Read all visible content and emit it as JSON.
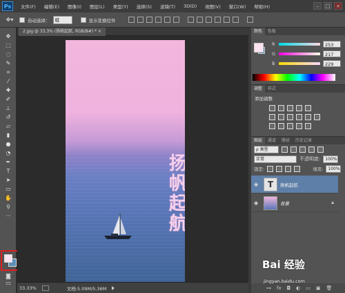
{
  "menubar": {
    "logo": "Ps",
    "items": [
      "文件(F)",
      "编辑(E)",
      "图像(I)",
      "图层(L)",
      "类型(Y)",
      "选择(S)",
      "滤镜(T)",
      "3D(D)",
      "视图(V)",
      "窗口(W)",
      "帮助(H)"
    ],
    "window_controls": [
      "–",
      "□",
      "×"
    ]
  },
  "options": {
    "auto_select_label": "自动选择：",
    "auto_select_value": "组",
    "show_transform_label": "显示变换控件"
  },
  "document": {
    "tab_title": "2.jpg @ 33.3% (扬帆起航, RGB/8#) * ×",
    "vertical_text": "扬帆起航"
  },
  "status": {
    "zoom": "33.33%",
    "doc_size": "文档:5.09M/5.36M"
  },
  "color_panel": {
    "tabs": [
      "颜色",
      "色板"
    ],
    "channels": [
      {
        "label": "R",
        "value": "253"
      },
      {
        "label": "G",
        "value": "217"
      },
      {
        "label": "B",
        "value": "229"
      }
    ]
  },
  "adjustments_panel": {
    "tabs": [
      "调整",
      "样式"
    ],
    "heading": "添加调整"
  },
  "layers_panel": {
    "tabs": [
      "图层",
      "通道",
      "路径",
      "历史记录"
    ],
    "filter": "ρ 类型",
    "blend_mode": "正常",
    "opacity_label": "不透明度:",
    "opacity_value": "100%",
    "lock_label": "锁定:",
    "fill_label": "填充:",
    "fill_value": "100%",
    "layers": [
      {
        "name": "扬帆起航",
        "thumb": "T"
      },
      {
        "name": "背景",
        "thumb": ""
      }
    ]
  },
  "watermark": {
    "brand": "Bai 经验",
    "url": "jingyan.baidu.com"
  },
  "colors": {
    "foreground": "#fce3f0",
    "background": "#5d8fb8",
    "highlight_box": "#e02020"
  }
}
